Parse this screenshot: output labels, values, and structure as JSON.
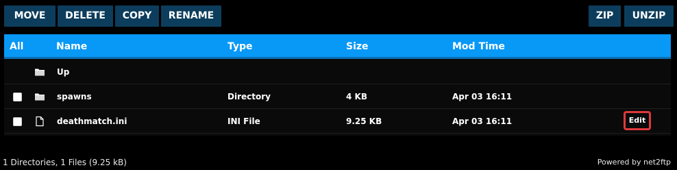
{
  "toolbar": {
    "move": "MOVE",
    "delete": "DELETE",
    "copy": "COPY",
    "rename": "RENAME",
    "zip": "ZIP",
    "unzip": "UNZIP"
  },
  "table": {
    "headers": {
      "all": "All",
      "name": "Name",
      "type": "Type",
      "size": "Size",
      "mod_time": "Mod Time"
    },
    "rows": [
      {
        "name": "Up",
        "type": "",
        "size": "",
        "mod_time": "",
        "icon": "folder-icon"
      },
      {
        "name": "spawns",
        "type": "Directory",
        "size": "4 KB",
        "mod_time": "Apr 03 16:11",
        "icon": "folder-icon"
      },
      {
        "name": "deathmatch.ini",
        "type": "INI File",
        "size": "9.25 KB",
        "mod_time": "Apr 03 16:11",
        "icon": "file-icon",
        "action": "Edit"
      }
    ]
  },
  "footer": {
    "summary": "1 Directories, 1 Files (9.25 kB)",
    "powered_by": "Powered by net2ftp"
  },
  "colors": {
    "background": "#000000",
    "button": "#0d3d5c",
    "header": "#0898f6",
    "edit_border": "#e0393c"
  }
}
